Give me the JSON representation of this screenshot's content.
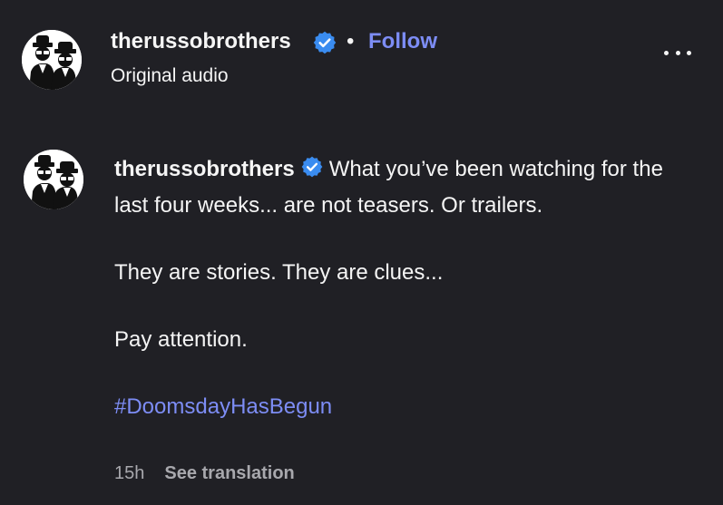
{
  "header": {
    "username": "therussobrothers",
    "separator": "•",
    "follow_label": "Follow",
    "audio_label": "Original audio",
    "verified_icon": "verified-badge-icon",
    "more_icon": "more-options-icon"
  },
  "caption": {
    "username": "therussobrothers",
    "line1": "What you’ve been watching for the last four weeks... are not teasers. Or trailers.",
    "line2": "They are stories. They are clues...",
    "line3": "Pay attention.",
    "hashtag": "#DoomsdayHasBegun"
  },
  "meta": {
    "time": "15h",
    "translate_label": "See translation"
  },
  "colors": {
    "background": "#202025",
    "text": "#f5f5f5",
    "link": "#7d8df5",
    "verified": "#3a8cf0",
    "muted": "#a8a8ad"
  }
}
